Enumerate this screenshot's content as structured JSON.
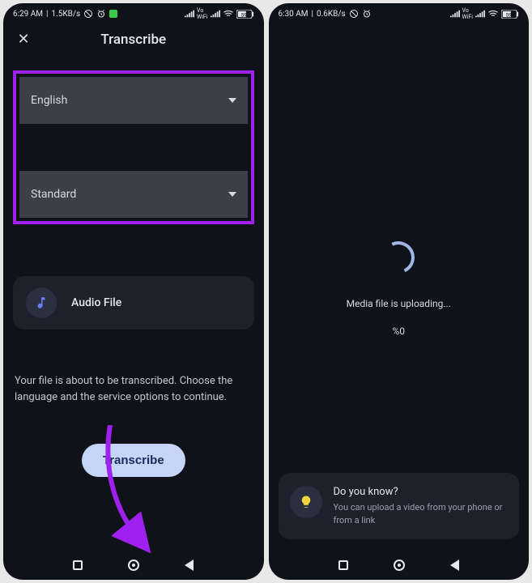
{
  "screen1": {
    "status": {
      "time": "6:29 AM",
      "net": "1.5KB/s",
      "battery": "59"
    },
    "title": "Transcribe",
    "language_select": "English",
    "quality_select": "Standard",
    "file_label": "Audio File",
    "help_text": "Your file is about to be transcribed. Choose the language and the service options to continue.",
    "button_label": "Transcribe"
  },
  "screen2": {
    "status": {
      "time": "6:30 AM",
      "net": "0.6KB/s",
      "battery": "59"
    },
    "uploading_text": "Media file is uploading...",
    "percent_text": "%0",
    "tip_title": "Do you know?",
    "tip_body": "You can upload a video from your phone or from a link"
  }
}
